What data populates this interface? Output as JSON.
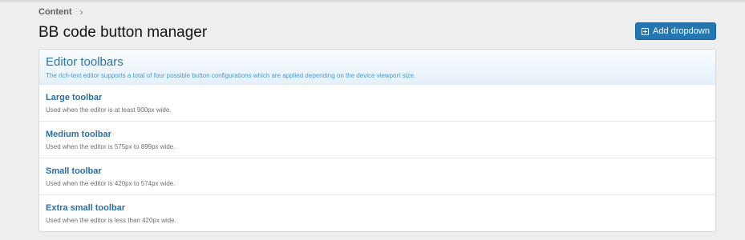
{
  "breadcrumb": {
    "item": "Content",
    "separator": "›"
  },
  "page_title": "BB code button manager",
  "actions": {
    "add_dropdown_label": "Add dropdown",
    "add_dropdown_icon": "plus-square-icon"
  },
  "panel": {
    "title": "Editor toolbars",
    "description": "The rich-text editor supports a total of four possible button configurations which are applied depending on the device viewport size.",
    "rows": [
      {
        "title": "Large toolbar",
        "desc": "Used when the editor is at least 900px wide."
      },
      {
        "title": "Medium toolbar",
        "desc": "Used when the editor is 575px to 899px wide."
      },
      {
        "title": "Small toolbar",
        "desc": "Used when the editor is 420px to 574px wide."
      },
      {
        "title": "Extra small toolbar",
        "desc": "Used when the editor is less than 420px wide."
      }
    ]
  },
  "colors": {
    "accent": "#2577b1",
    "link": "#2b6ea3",
    "header_bg": "#e5f0fa",
    "page_bg": "#eeeeee"
  }
}
